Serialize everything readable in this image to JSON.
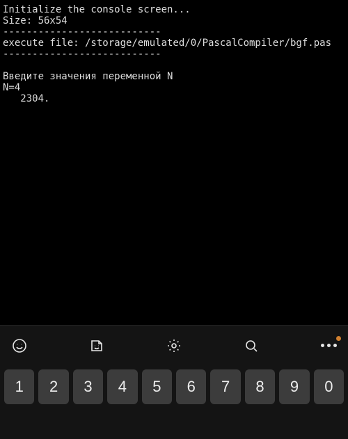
{
  "console": {
    "lines": [
      "Initialize the console screen...",
      "Size: 56x54",
      "---------------------------",
      "execute file: /storage/emulated/0/PascalCompiler/bgf.pas",
      "---------------------------",
      "",
      "Введите значения переменной N",
      "N=4",
      "   2304."
    ]
  },
  "keyboard": {
    "keys": [
      "1",
      "2",
      "3",
      "4",
      "5",
      "6",
      "7",
      "8",
      "9",
      "0"
    ]
  }
}
